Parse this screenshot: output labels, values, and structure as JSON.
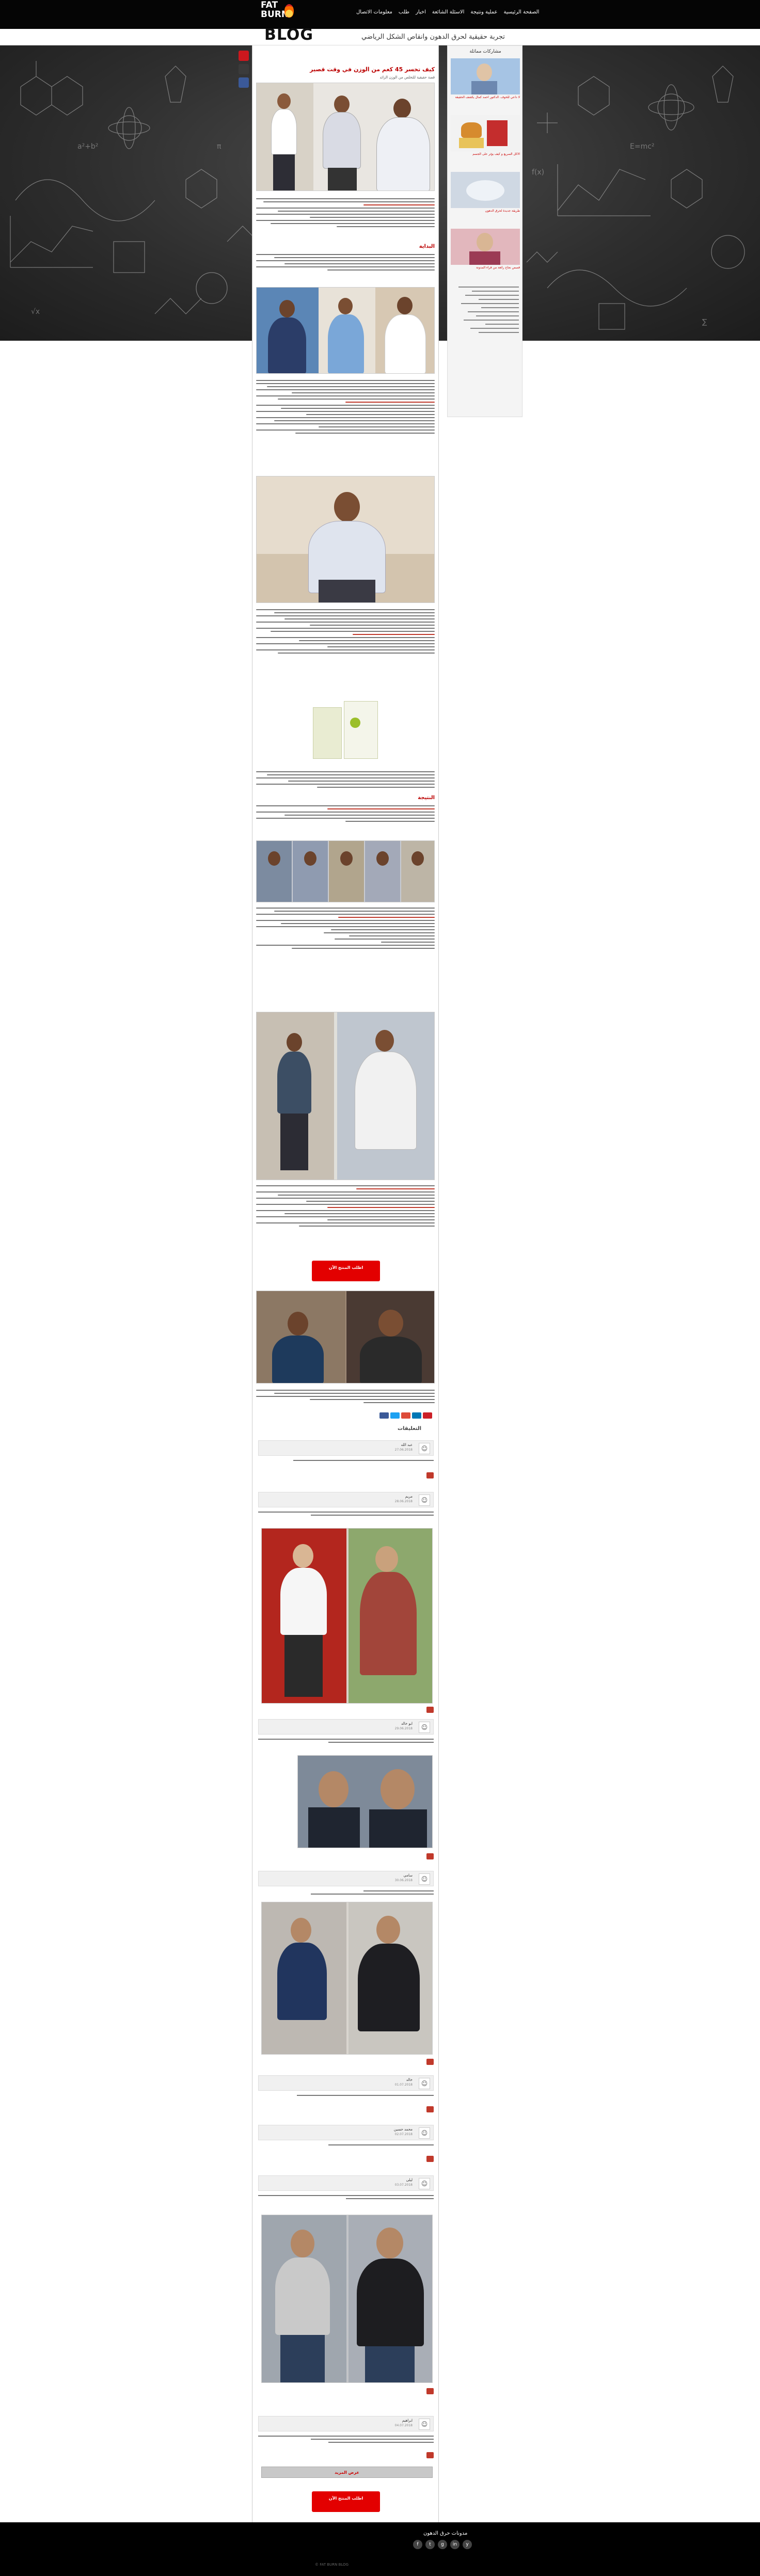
{
  "header": {
    "logo_line1": "FAT",
    "logo_line2": "BURN",
    "nav": [
      "الصفحة الرئيسية",
      "عملية ونتيجة",
      "الاسئلة الشائعة",
      "اخبار",
      "طلب",
      "معلومات الاتصال"
    ],
    "blog_word": "BLOG",
    "slogan": "تجربة حقيقية لحرق الدهون وانقاص الشكل الرياضي"
  },
  "sidebar": {
    "title": "مشاركات مماثلة",
    "items": [
      "لا داعي للخوف. الدكتور احمد كمال يكشف الحقيقة",
      "الاكل السريع و كيف يؤثر على الجسم",
      "طريقة جديدة لحرق الدهون",
      "قصص نجاح رائعة من قراء المدونة"
    ]
  },
  "article": {
    "title": "كيف تخسر 45 كغم من الوزن في وقت قصير",
    "subtitle": "قصة حقيقية للتخلص من الوزن الزائد",
    "heading1": "البداية",
    "heading2": "النتيجة",
    "cta1": "اطلب المنتج الآن",
    "cta2": "اطلب المنتج الآن",
    "share_labels": [
      "f",
      "t",
      "g+",
      "in",
      "p"
    ]
  },
  "comments": {
    "title": "التعليقات",
    "list": [
      {
        "name": "عبد الله",
        "date": "27.06.2018"
      },
      {
        "name": "مريم",
        "date": "28.06.2018"
      },
      {
        "name": "ابو خالد",
        "date": "29.06.2018"
      },
      {
        "name": "سامي",
        "date": "30.06.2018"
      },
      {
        "name": "خالد",
        "date": "01.07.2018"
      },
      {
        "name": "محمد حسين",
        "date": "02.07.2018"
      },
      {
        "name": "ليلى",
        "date": "03.07.2018"
      },
      {
        "name": "ابراهيم",
        "date": "04.07.2018"
      }
    ],
    "load_more": "عرض المزيد",
    "cta": "اطلب المنتج الآن"
  },
  "footer": {
    "title": "مدونات حرق الدهون",
    "icons": [
      "f",
      "t",
      "g",
      "in",
      "y"
    ],
    "copyright": "© FAT BURN BLOG"
  },
  "colors": {
    "accent_red": "#e30000",
    "chalkboard": "#2e2e2e"
  }
}
